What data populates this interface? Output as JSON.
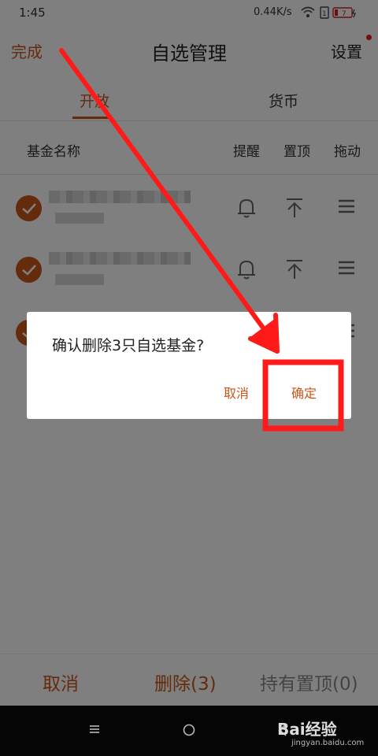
{
  "status": {
    "time": "1:45",
    "network_speed": "0.44K/s",
    "battery": "7"
  },
  "header": {
    "done_label": "完成",
    "title": "自选管理",
    "settings_label": "设置"
  },
  "tabs": [
    {
      "label": "开放",
      "active": true
    },
    {
      "label": "货币",
      "active": false
    }
  ],
  "columns": {
    "name": "基金名称",
    "remind": "提醒",
    "pin": "置顶",
    "drag": "拖动"
  },
  "bottom_bar": {
    "cancel": "取消",
    "delete": "删除(3)",
    "pin_holding": "持有置顶(0)"
  },
  "dialog": {
    "message": "确认删除3只自选基金?",
    "cancel": "取消",
    "confirm": "确定"
  },
  "watermark": {
    "brand": "Bai经验",
    "url": "jingyan.baidu.com"
  },
  "colors": {
    "accent": "#c8561a",
    "annotation": "#ff1a1a"
  }
}
